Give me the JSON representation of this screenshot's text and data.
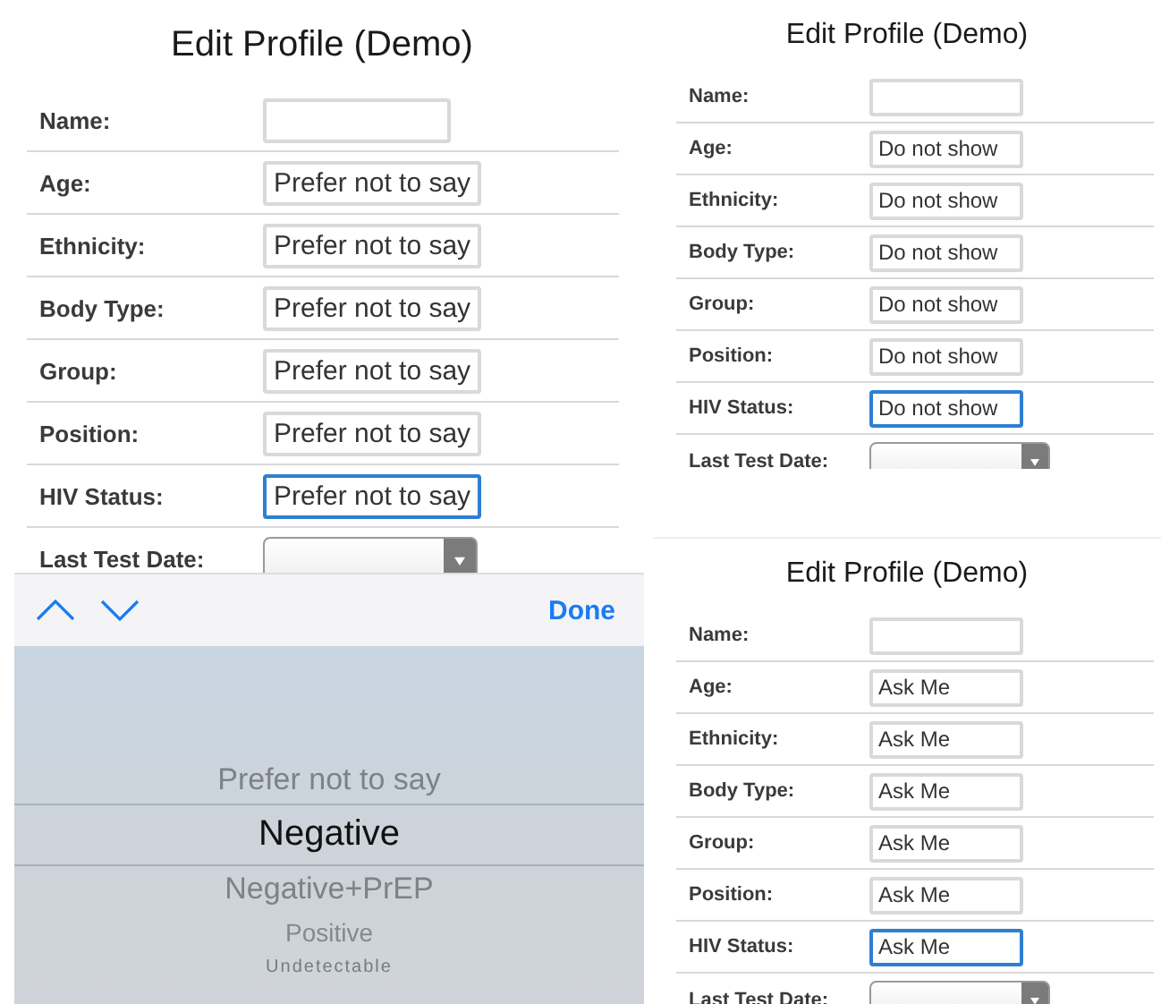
{
  "panels": [
    {
      "title": "Edit Profile (Demo)",
      "fields": [
        {
          "label": "Name:",
          "kind": "text",
          "focused": false
        },
        {
          "label": "Age:",
          "kind": "text",
          "value": "Prefer not to say",
          "focused": false
        },
        {
          "label": "Ethnicity:",
          "kind": "text",
          "value": "Prefer not to say",
          "focused": false
        },
        {
          "label": "Body Type:",
          "kind": "text",
          "value": "Prefer not to say",
          "focused": false
        },
        {
          "label": "Group:",
          "kind": "text",
          "value": "Prefer not to say",
          "focused": false
        },
        {
          "label": "Position:",
          "kind": "text",
          "value": "Prefer not to say",
          "focused": false
        },
        {
          "label": "HIV Status:",
          "kind": "text",
          "value": "Prefer not to say",
          "focused": true
        },
        {
          "label": "Last Test Date:",
          "kind": "date-select",
          "focused": false
        }
      ]
    },
    {
      "title": "Edit Profile (Demo)",
      "fields": [
        {
          "label": "Name:",
          "kind": "text",
          "focused": false
        },
        {
          "label": "Age:",
          "kind": "text",
          "value": "Do not show",
          "focused": false
        },
        {
          "label": "Ethnicity:",
          "kind": "text",
          "value": "Do not show",
          "focused": false
        },
        {
          "label": "Body Type:",
          "kind": "text",
          "value": "Do not show",
          "focused": false
        },
        {
          "label": "Group:",
          "kind": "text",
          "value": "Do not show",
          "focused": false
        },
        {
          "label": "Position:",
          "kind": "text",
          "value": "Do not show",
          "focused": false
        },
        {
          "label": "HIV Status:",
          "kind": "text",
          "value": "Do not show",
          "focused": true
        },
        {
          "label": "Last Test Date:",
          "kind": "date-select",
          "focused": false
        }
      ]
    },
    {
      "title": "Edit Profile (Demo)",
      "fields": [
        {
          "label": "Name:",
          "kind": "text",
          "focused": false
        },
        {
          "label": "Age:",
          "kind": "text",
          "value": "Ask Me",
          "focused": false
        },
        {
          "label": "Ethnicity:",
          "kind": "text",
          "value": "Ask Me",
          "focused": false
        },
        {
          "label": "Body Type:",
          "kind": "text",
          "value": "Ask Me",
          "focused": false
        },
        {
          "label": "Group:",
          "kind": "text",
          "value": "Ask Me",
          "focused": false
        },
        {
          "label": "Position:",
          "kind": "text",
          "value": "Ask Me",
          "focused": false
        },
        {
          "label": "HIV Status:",
          "kind": "text",
          "value": "Ask Me",
          "focused": true
        },
        {
          "label": "Last Test Date:",
          "kind": "date-select",
          "focused": false
        }
      ]
    }
  ],
  "picker": {
    "done": "Done",
    "options": [
      {
        "label": "Prefer not to say",
        "selected": false
      },
      {
        "label": "Negative",
        "selected": true
      },
      {
        "label": "Negative+PrEP",
        "selected": false
      },
      {
        "label": "Positive",
        "selected": false
      },
      {
        "label": "Undetectable",
        "selected": false
      }
    ]
  }
}
